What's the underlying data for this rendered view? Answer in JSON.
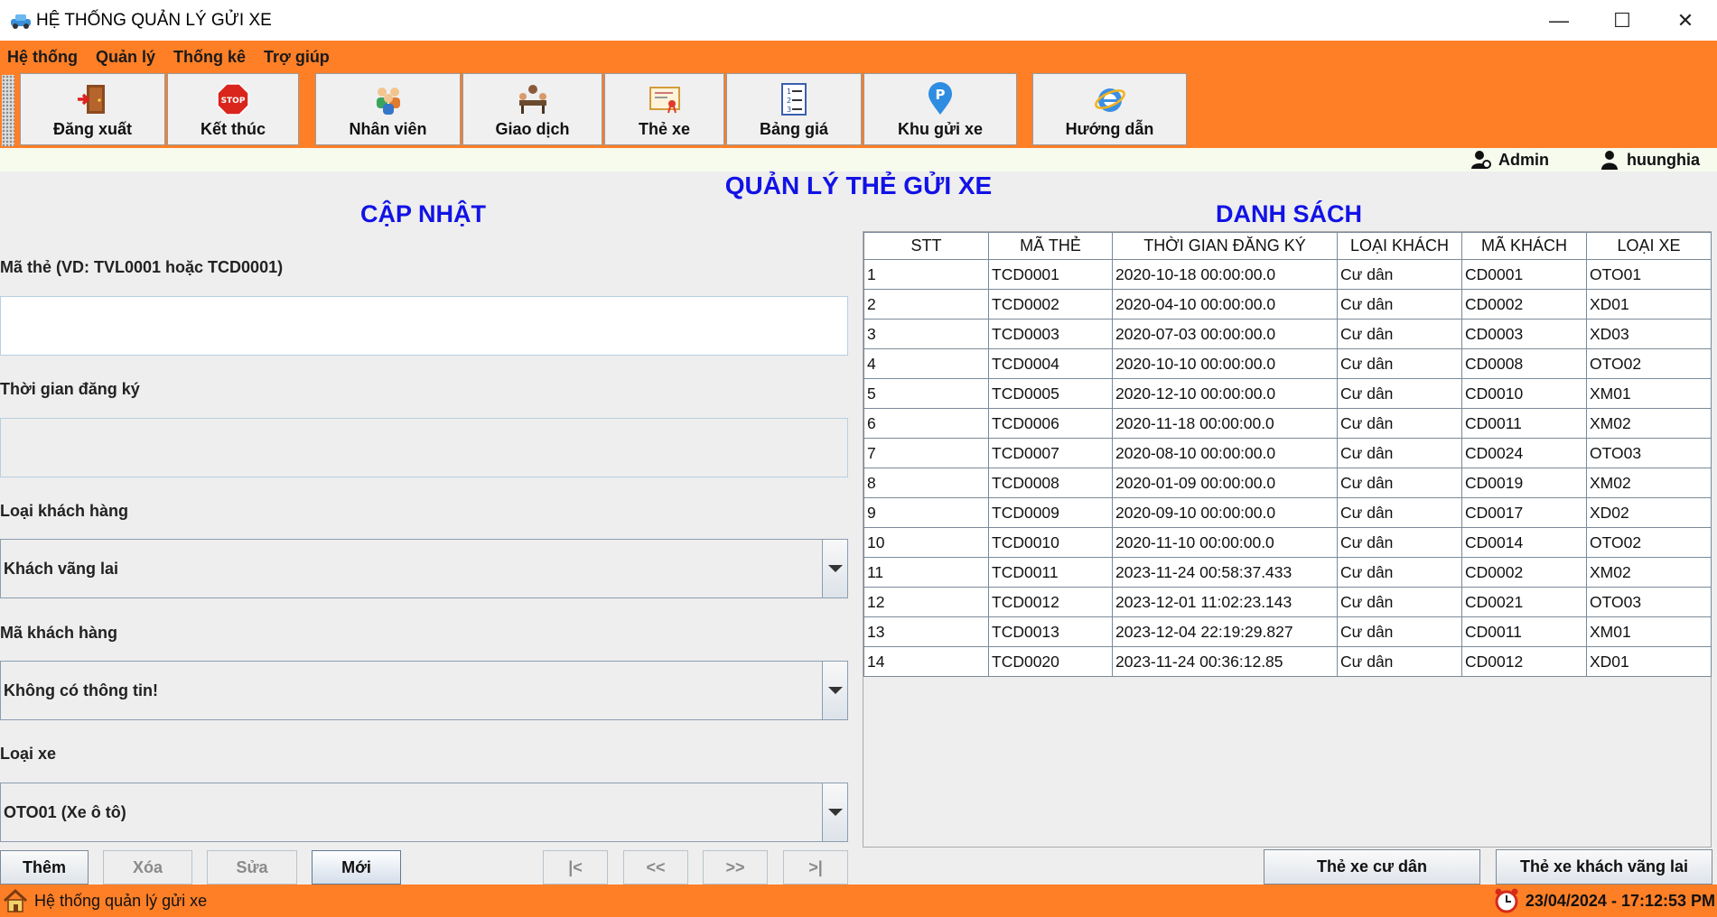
{
  "window": {
    "title": "HỆ THỐNG QUẢN LÝ GỬI XE",
    "minimize": "—",
    "maximize": "☐",
    "close": "✕"
  },
  "menu": [
    "Hệ thống",
    "Quản lý",
    "Thống kê",
    "Trợ giúp"
  ],
  "toolbar": {
    "logout": "Đăng xuất",
    "exit": "Kết thúc",
    "staff": "Nhân viên",
    "transactions": "Giao dịch",
    "cards": "Thẻ xe",
    "pricing": "Bảng giá",
    "parking_area": "Khu gửi xe",
    "guide": "Hướng dẫn"
  },
  "user": {
    "role": "Admin",
    "username": "huunghia"
  },
  "page_title": "QUẢN LÝ THẺ GỬI XE",
  "form": {
    "heading": "CẬP NHẬT",
    "card_id_label": "Mã thẻ (VD: TVL0001 hoặc TCD0001)",
    "card_id_value": "",
    "reg_time_label": "Thời gian đăng ký",
    "reg_time_value": "",
    "customer_type_label": "Loại khách hàng",
    "customer_type_value": "Khách vãng lai",
    "customer_id_label": "Mã khách hàng",
    "customer_id_value": "Không có thông tin!",
    "vehicle_type_label": "Loại xe",
    "vehicle_type_value": "OTO01 (Xe ô tô)"
  },
  "buttons": {
    "add": "Thêm",
    "delete": "Xóa",
    "edit": "Sửa",
    "new": "Mới",
    "first": "|<",
    "prev": "<<",
    "next": ">>",
    "last": ">|",
    "resident_cards": "Thẻ xe cư dân",
    "guest_cards": "Thẻ xe khách vãng lai"
  },
  "list": {
    "heading": "DANH SÁCH",
    "columns": [
      "STT",
      "MÃ THẺ",
      "THỜI GIAN ĐĂNG KÝ",
      "LOẠI KHÁCH",
      "MÃ KHÁCH",
      "LOẠI XE"
    ],
    "rows": [
      [
        "1",
        "TCD0001",
        "2020-10-18 00:00:00.0",
        "Cư dân",
        "CD0001",
        "OTO01"
      ],
      [
        "2",
        "TCD0002",
        "2020-04-10 00:00:00.0",
        "Cư dân",
        "CD0002",
        "XD01"
      ],
      [
        "3",
        "TCD0003",
        "2020-07-03 00:00:00.0",
        "Cư dân",
        "CD0003",
        "XD03"
      ],
      [
        "4",
        "TCD0004",
        "2020-10-10 00:00:00.0",
        "Cư dân",
        "CD0008",
        "OTO02"
      ],
      [
        "5",
        "TCD0005",
        "2020-12-10 00:00:00.0",
        "Cư dân",
        "CD0010",
        "XM01"
      ],
      [
        "6",
        "TCD0006",
        "2020-11-18 00:00:00.0",
        "Cư dân",
        "CD0011",
        "XM02"
      ],
      [
        "7",
        "TCD0007",
        "2020-08-10 00:00:00.0",
        "Cư dân",
        "CD0024",
        "OTO03"
      ],
      [
        "8",
        "TCD0008",
        "2020-01-09 00:00:00.0",
        "Cư dân",
        "CD0019",
        "XM02"
      ],
      [
        "9",
        "TCD0009",
        "2020-09-10 00:00:00.0",
        "Cư dân",
        "CD0017",
        "XD02"
      ],
      [
        "10",
        "TCD0010",
        "2020-11-10 00:00:00.0",
        "Cư dân",
        "CD0014",
        "OTO02"
      ],
      [
        "11",
        "TCD0011",
        "2023-11-24 00:58:37.433",
        "Cư dân",
        "CD0002",
        "XM02"
      ],
      [
        "12",
        "TCD0012",
        "2023-12-01 11:02:23.143",
        "Cư dân",
        "CD0021",
        "OTO03"
      ],
      [
        "13",
        "TCD0013",
        "2023-12-04 22:19:29.827",
        "Cư dân",
        "CD0011",
        "XM01"
      ],
      [
        "14",
        "TCD0020",
        "2023-11-24 00:36:12.85",
        "Cư dân",
        "CD0012",
        "XD01"
      ]
    ]
  },
  "status": {
    "text": "Hệ thống quản lý gửi xe",
    "datetime": "23/04/2024 - 17:12:53 PM"
  },
  "colors": {
    "accent": "#ff7f27",
    "heading": "#1212e6"
  }
}
